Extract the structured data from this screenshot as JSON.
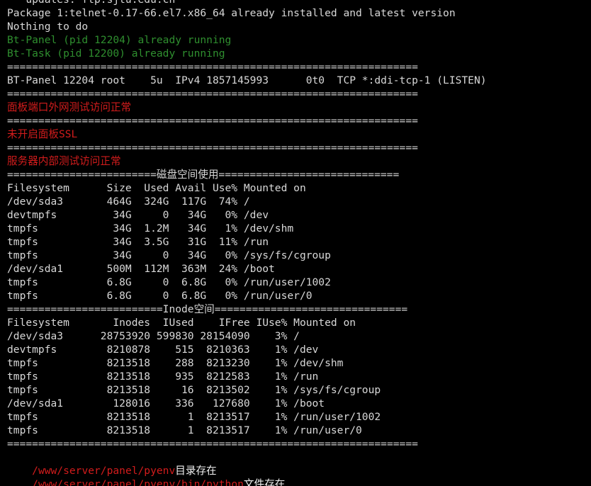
{
  "colors": {
    "background": "#000000",
    "foreground": "#d8d8d8",
    "green": "#2f8f2f",
    "red": "#d21c1c"
  },
  "terminal": {
    "lines": [
      {
        "text": " * updates: ftp.sjtu.edu.cn",
        "color": "default"
      },
      {
        "text": "Package 1:telnet-0.17-66.el7.x86_64 already installed and latest version",
        "color": "default"
      },
      {
        "text": "Nothing to do",
        "color": "default"
      },
      {
        "text": "Bt-Panel (pid 12204) already running",
        "color": "green"
      },
      {
        "text": "Bt-Task (pid 12200) already running",
        "color": "green"
      },
      {
        "text": "==================================================================",
        "color": "default"
      },
      {
        "text": "BT-Panel 12204 root    5u  IPv4 1857145993      0t0  TCP *:ddi-tcp-1 (LISTEN)",
        "color": "default"
      },
      {
        "text": "==================================================================",
        "color": "default"
      },
      {
        "text": "面板端口外网测试访问正常",
        "color": "red"
      },
      {
        "text": "==================================================================",
        "color": "default"
      },
      {
        "text": "未开启面板SSL",
        "color": "red"
      },
      {
        "text": "==================================================================",
        "color": "default"
      },
      {
        "text": "服务器内部测试访问正常",
        "color": "red"
      },
      {
        "text": "========================磁盘空间使用=============================",
        "color": "default"
      },
      {
        "text": "Filesystem      Size  Used Avail Use% Mounted on",
        "color": "default"
      },
      {
        "text": "/dev/sda3       464G  324G  117G  74% /",
        "color": "default"
      },
      {
        "text": "devtmpfs         34G     0   34G   0% /dev",
        "color": "default"
      },
      {
        "text": "tmpfs            34G  1.2M   34G   1% /dev/shm",
        "color": "default"
      },
      {
        "text": "tmpfs            34G  3.5G   31G  11% /run",
        "color": "default"
      },
      {
        "text": "tmpfs            34G     0   34G   0% /sys/fs/cgroup",
        "color": "default"
      },
      {
        "text": "/dev/sda1       500M  112M  363M  24% /boot",
        "color": "default"
      },
      {
        "text": "tmpfs           6.8G     0  6.8G   0% /run/user/1002",
        "color": "default"
      },
      {
        "text": "tmpfs           6.8G     0  6.8G   0% /run/user/0",
        "color": "default"
      },
      {
        "text": "=========================Inode空间===============================",
        "color": "default"
      },
      {
        "text": "Filesystem       Inodes  IUsed    IFree IUse% Mounted on",
        "color": "default"
      },
      {
        "text": "/dev/sda3      28753920 599830 28154090    3% /",
        "color": "default"
      },
      {
        "text": "devtmpfs        8210878    515  8210363    1% /dev",
        "color": "default"
      },
      {
        "text": "tmpfs           8213518    288  8213230    1% /dev/shm",
        "color": "default"
      },
      {
        "text": "tmpfs           8213518    935  8212583    1% /run",
        "color": "default"
      },
      {
        "text": "tmpfs           8213518     16  8213502    1% /sys/fs/cgroup",
        "color": "default"
      },
      {
        "text": "/dev/sda1        128016    336   127680    1% /boot",
        "color": "default"
      },
      {
        "text": "tmpfs           8213518      1  8213517    1% /run/user/1002",
        "color": "default"
      },
      {
        "text": "tmpfs           8213518      1  8213517    1% /run/user/0",
        "color": "default"
      },
      {
        "text": "==================================================================",
        "color": "default"
      }
    ],
    "dir_line": {
      "path": "/www/server/panel/pyenv",
      "suffix": "目录存在"
    },
    "file_line": {
      "path": "/www/server/panel/pyenv/bin/python",
      "suffix": "文件存在"
    }
  }
}
